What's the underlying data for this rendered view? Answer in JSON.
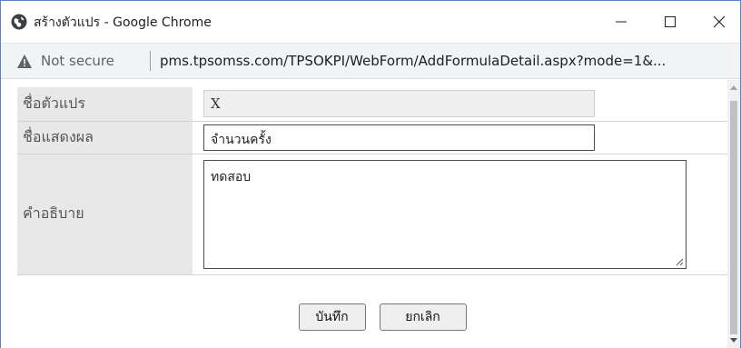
{
  "window": {
    "title": "สร้างตัวแปร - Google Chrome",
    "controls": {
      "minimize": "minimize",
      "maximize": "maximize",
      "close": "close"
    }
  },
  "address_bar": {
    "security_label": "Not secure",
    "url": "pms.tpsomss.com/TPSOKPI/WebForm/AddFormulaDetail.aspx?mode=1&..."
  },
  "form": {
    "variable_name": {
      "label": "ชื่อตัวแปร",
      "value": "X",
      "disabled": true
    },
    "display_name": {
      "label": "ชื่อแสดงผล",
      "value": "จำนวนครั้ง"
    },
    "description": {
      "label": "คำอธิบาย",
      "value": "ทดสอบ"
    }
  },
  "buttons": {
    "save": "บันทึก",
    "cancel": "ยกเลิก"
  },
  "colors": {
    "window_border": "#5a83c9",
    "label_background": "#e8e8e8",
    "address_bar_background": "#f1f3f4"
  }
}
